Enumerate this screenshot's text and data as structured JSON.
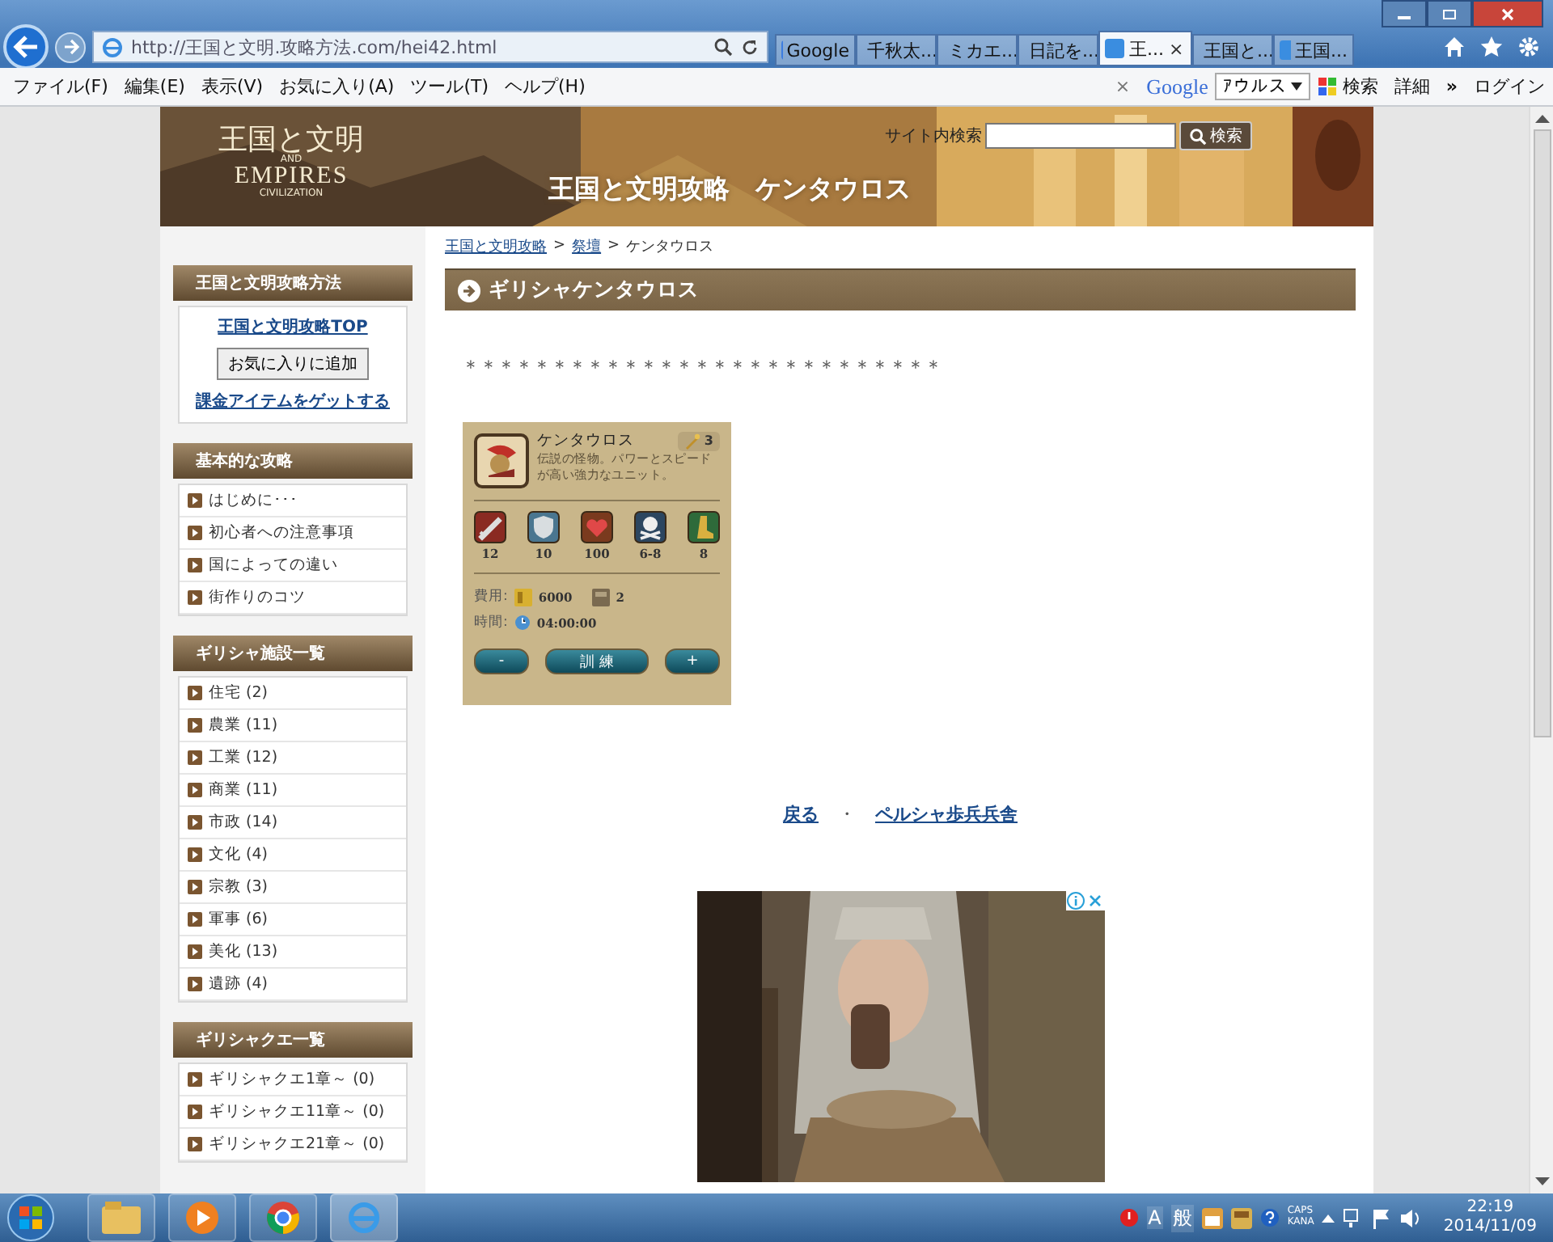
{
  "browser": {
    "address": "http://王国と文明.攻略方法.com/hei42.html",
    "tabs": [
      {
        "label": "Google",
        "selected": false,
        "kind": "google"
      },
      {
        "label": "千秋太...",
        "selected": false,
        "kind": "red"
      },
      {
        "label": "ミカエ...",
        "selected": false,
        "kind": "yahoo"
      },
      {
        "label": "日記を...",
        "selected": false,
        "kind": "yahoo"
      },
      {
        "label": "王...",
        "selected": true,
        "kind": "ie"
      },
      {
        "label": "王国と...",
        "selected": false,
        "kind": "ie"
      },
      {
        "label": "王国...",
        "selected": false,
        "kind": "ie"
      }
    ],
    "close_tab": "×",
    "menu": [
      "ファイル(F)",
      "編集(E)",
      "表示(V)",
      "お気に入り(A)",
      "ツール(T)",
      "ヘルプ(H)"
    ],
    "toolbar": {
      "close": "×",
      "google": "Google",
      "query": "ｱウルス",
      "search": "検索",
      "more": "詳細",
      "chevron": "»",
      "login": "ログイン"
    }
  },
  "header": {
    "logo": [
      "王国と文明",
      "AND",
      "EMPIRES",
      "CIVILIZATION"
    ],
    "search_label": "サイト内検索",
    "search_button": "検索",
    "title": "王国と文明攻略　ケンタウロス"
  },
  "sidebar": [
    {
      "title": "王国と文明攻略方法",
      "kind": "actions",
      "items": [
        {
          "label": "王国と文明攻略TOP",
          "kind": "link"
        },
        {
          "label": "お気に入りに追加",
          "kind": "button"
        },
        {
          "label": "課金アイテムをゲットする",
          "kind": "link"
        }
      ]
    },
    {
      "title": "基本的な攻略",
      "kind": "list",
      "items": [
        {
          "label": "はじめに･･･"
        },
        {
          "label": "初心者への注意事項"
        },
        {
          "label": "国によっての違い"
        },
        {
          "label": "街作りのコツ"
        }
      ]
    },
    {
      "title": "ギリシャ施設一覧",
      "kind": "list",
      "items": [
        {
          "label": "住宅 (2)"
        },
        {
          "label": "農業 (11)"
        },
        {
          "label": "工業 (12)"
        },
        {
          "label": "商業 (11)"
        },
        {
          "label": "市政 (14)"
        },
        {
          "label": "文化 (4)"
        },
        {
          "label": "宗教 (3)"
        },
        {
          "label": "軍事 (6)"
        },
        {
          "label": "美化 (13)"
        },
        {
          "label": "遺跡 (4)"
        }
      ]
    },
    {
      "title": "ギリシャクエ一覧",
      "kind": "list",
      "items": [
        {
          "label": "ギリシャクエ1章～ (0)"
        },
        {
          "label": "ギリシャクエ11章～ (0)"
        },
        {
          "label": "ギリシャクエ21章～ (0)"
        }
      ]
    }
  ],
  "main": {
    "breadcrumb": [
      {
        "label": "王国と文明攻略",
        "link": true
      },
      {
        "label": "祭壇",
        "link": true
      },
      {
        "label": "ケンタウロス",
        "link": false
      }
    ],
    "separator": ">",
    "heading": "ギリシャケンタウロス",
    "stars": "＊＊＊＊＊＊＊＊＊＊＊＊＊＊＊＊＊＊＊＊＊＊＊＊＊＊＊",
    "unit": {
      "name": "ケンタウロス",
      "badge": "3",
      "description": "伝説の怪物。パワーとスピードが高い強力なユニット。",
      "stats": [
        {
          "kind": "attack",
          "value": "12"
        },
        {
          "kind": "defense",
          "value": "10"
        },
        {
          "kind": "health",
          "value": "100"
        },
        {
          "kind": "damage",
          "value": "6-8"
        },
        {
          "kind": "speed",
          "value": "8"
        }
      ],
      "cost_label": "費用:",
      "cost_gold": "6000",
      "cost_supply": "2",
      "time_label": "時間:",
      "time": "04:00:00",
      "buttons": [
        "-",
        "訓 練",
        "+"
      ]
    },
    "nav": [
      {
        "label": "戻る",
        "kind": "link"
      },
      {
        "label": "・",
        "kind": "dot"
      },
      {
        "label": "ペルシャ歩兵兵舎",
        "kind": "link"
      }
    ]
  },
  "taskbar": {
    "ime": [
      "A",
      "般"
    ],
    "caps": "CAPS",
    "kana": "KANA",
    "time": "22:19",
    "date": "2014/11/09"
  }
}
